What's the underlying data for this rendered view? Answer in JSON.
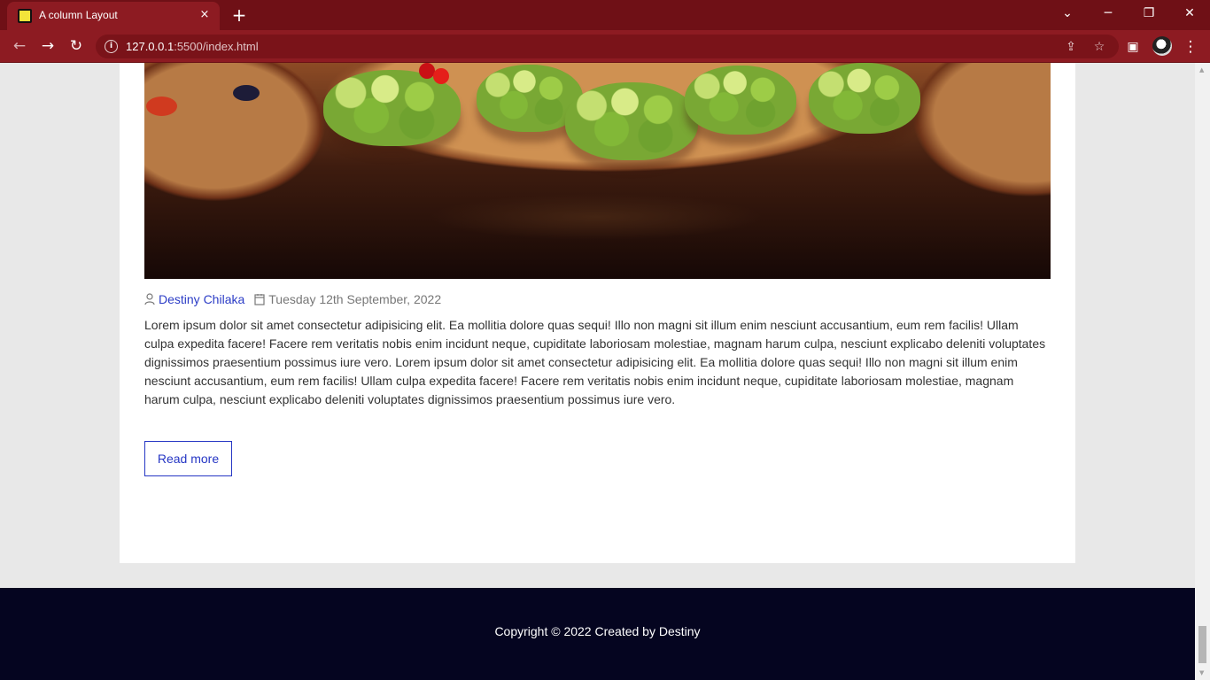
{
  "browser": {
    "tab_title": "A column Layout",
    "tab_close": "×",
    "new_tab": "+",
    "minimize": "─",
    "restore": "❐",
    "close_window": "✕",
    "dropdown": "⌄",
    "address_host": "127.0.0.1",
    "address_path": ":5500/index.html",
    "back": "←",
    "forward": "→",
    "reload": "↻",
    "info": "i",
    "share": "⇪",
    "bookmark": "☆",
    "sidebar": "▣",
    "menu": "⋮"
  },
  "article": {
    "author": "Destiny Chilaka",
    "date": "Tuesday 12th September, 2022",
    "body": "Lorem ipsum dolor sit amet consectetur adipisicing elit. Ea mollitia dolore quas sequi! Illo non magni sit illum enim nesciunt accusantium, eum rem facilis! Ullam culpa expedita facere! Facere rem veritatis nobis enim incidunt neque, cupiditate laboriosam molestiae, magnam harum culpa, nesciunt explicabo deleniti voluptates dignissimos praesentium possimus iure vero. Lorem ipsum dolor sit amet consectetur adipisicing elit. Ea mollitia dolore quas sequi! Illo non magni sit illum enim nesciunt accusantium, eum rem facilis! Ullam culpa expedita facere! Facere rem veritatis nobis enim incidunt neque, cupiditate laboriosam molestiae, magnam harum culpa, nesciunt explicabo deleniti voluptates dignissimos praesentium possimus iure vero.",
    "read_more": "Read more"
  },
  "footer": {
    "copyright": "Copyright © 2022 Created by Destiny"
  },
  "icons": {
    "author": "user-icon",
    "date": "calendar-icon",
    "favicon": "site-favicon-icon"
  },
  "colors": {
    "browser_dark": "#6f1016",
    "browser_main": "#8d1b22",
    "link": "#2b3cc6",
    "button": "#2536c4",
    "footer": "#050520"
  }
}
